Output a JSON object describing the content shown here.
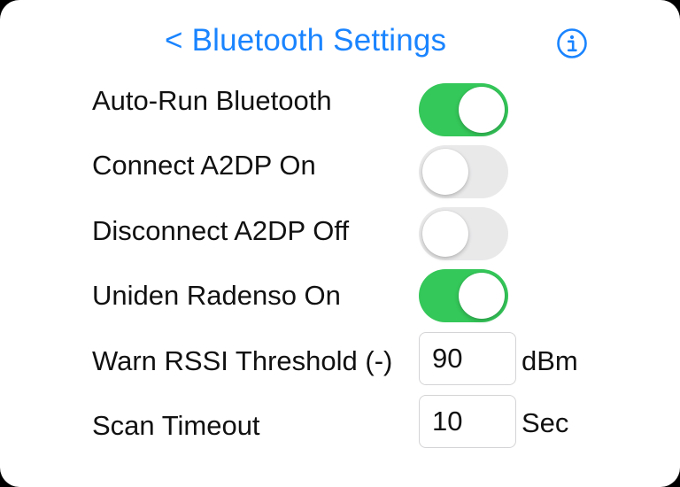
{
  "header": {
    "title": "< Bluetooth Settings",
    "info_icon": "info-circle-icon",
    "accent_color": "#1a84ff"
  },
  "settings": {
    "auto_run_bluetooth": {
      "label": "Auto-Run Bluetooth",
      "enabled": true
    },
    "connect_a2dp_on": {
      "label": "Connect A2DP On",
      "enabled": false
    },
    "disconnect_a2dp_off": {
      "label": "Disconnect A2DP Off",
      "enabled": false
    },
    "uniden_radenso_on": {
      "label": "Uniden Radenso On",
      "enabled": true
    },
    "warn_rssi_threshold": {
      "label": "Warn RSSI Threshold (-)",
      "value": "90",
      "unit": "dBm"
    },
    "scan_timeout": {
      "label": "Scan Timeout",
      "value": "10",
      "unit": "Sec"
    }
  },
  "colors": {
    "toggle_on": "#34c759",
    "toggle_off": "#e9e9ea"
  }
}
